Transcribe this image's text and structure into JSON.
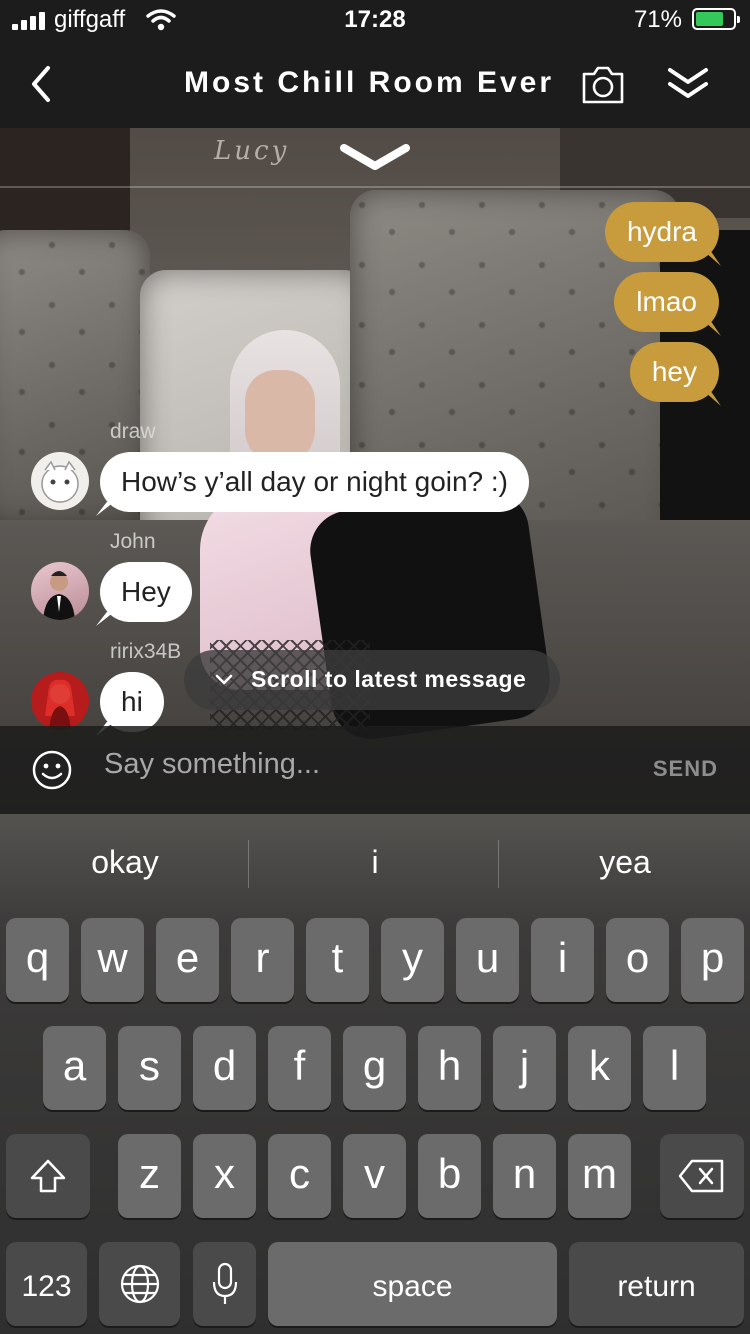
{
  "status_bar": {
    "carrier": "giffgaff",
    "time": "17:28",
    "battery": "71%",
    "battery_level": 0.71
  },
  "nav": {
    "title": "Most Chill Room Ever",
    "back_icon": "chevron-left-icon",
    "camera_icon": "camera-icon",
    "collapse_icon": "double-chevron-down-icon"
  },
  "scene": {
    "nameplate": "Lucy"
  },
  "chat": {
    "my_messages": [
      "hydra",
      "lmao",
      "hey"
    ],
    "messages": [
      {
        "sender": "draw",
        "text": "How’s y’all day or night goin? :)"
      },
      {
        "sender": "John",
        "text": "Hey"
      },
      {
        "sender": "ririx34B",
        "text": "hi"
      }
    ],
    "scroll_label": "Scroll to latest message"
  },
  "input": {
    "placeholder": "Say something...",
    "send_label": "SEND"
  },
  "keyboard": {
    "suggestions": [
      "okay",
      "i",
      "yea"
    ],
    "row1": [
      "q",
      "w",
      "e",
      "r",
      "t",
      "y",
      "u",
      "i",
      "o",
      "p"
    ],
    "row2": [
      "a",
      "s",
      "d",
      "f",
      "g",
      "h",
      "j",
      "k",
      "l"
    ],
    "row3": [
      "z",
      "x",
      "c",
      "v",
      "b",
      "n",
      "m"
    ],
    "numbers_label": "123",
    "space_label": "space",
    "return_label": "return"
  },
  "colors": {
    "my_bubble": "#c89b3c",
    "their_bubble": "#ffffff",
    "bar": "#1c1c1c"
  }
}
